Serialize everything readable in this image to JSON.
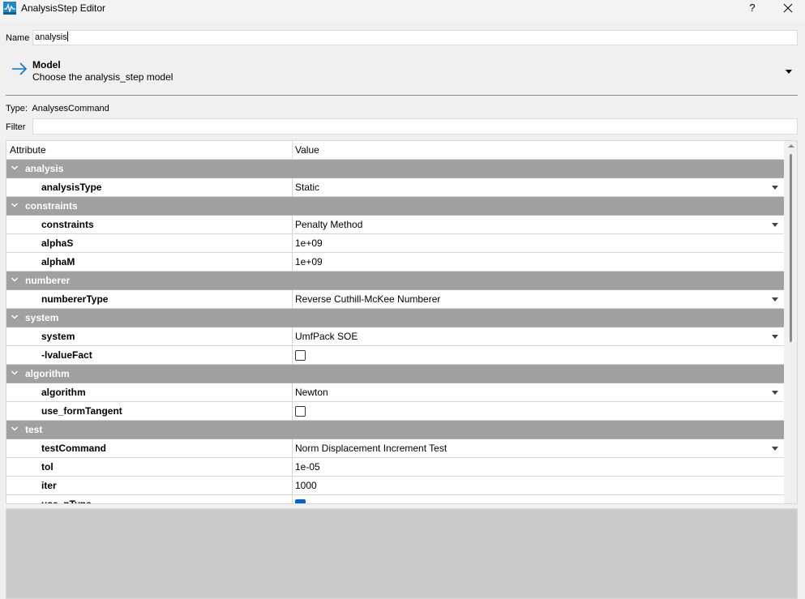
{
  "window": {
    "title": "AnalysisStep Editor",
    "help_label": "?",
    "icon": "app-icon"
  },
  "name": {
    "label": "Name",
    "value": "analysis"
  },
  "model": {
    "title": "Model",
    "subtitle": "Choose the analysis_step model",
    "icon": "arrow-right-icon"
  },
  "type": {
    "label": "Type:",
    "value": "AnalysesCommand"
  },
  "filter": {
    "label": "Filter",
    "value": ""
  },
  "table": {
    "columns": [
      "Attribute",
      "Value"
    ],
    "rows": [
      {
        "kind": "group",
        "label": "analysis"
      },
      {
        "kind": "attr",
        "label": "analysisType",
        "value": "Static",
        "editor": "dropdown"
      },
      {
        "kind": "group",
        "label": "constraints"
      },
      {
        "kind": "attr",
        "label": "constraints",
        "value": "Penalty Method",
        "editor": "dropdown"
      },
      {
        "kind": "attr",
        "label": "alphaS",
        "value": "1e+09",
        "editor": "text"
      },
      {
        "kind": "attr",
        "label": "alphaM",
        "value": "1e+09",
        "editor": "text"
      },
      {
        "kind": "group",
        "label": "numberer"
      },
      {
        "kind": "attr",
        "label": "numbererType",
        "value": "Reverse Cuthill-McKee Numberer",
        "editor": "dropdown"
      },
      {
        "kind": "group",
        "label": "system"
      },
      {
        "kind": "attr",
        "label": "system",
        "value": "UmfPack SOE",
        "editor": "dropdown"
      },
      {
        "kind": "attr",
        "label": "-lvalueFact",
        "value": "",
        "editor": "checkbox",
        "checked": false
      },
      {
        "kind": "group",
        "label": "algorithm"
      },
      {
        "kind": "attr",
        "label": "algorithm",
        "value": "Newton",
        "editor": "dropdown"
      },
      {
        "kind": "attr",
        "label": "use_formTangent",
        "value": "",
        "editor": "checkbox",
        "checked": false
      },
      {
        "kind": "group",
        "label": "test"
      },
      {
        "kind": "attr",
        "label": "testCommand",
        "value": "Norm Displacement Increment Test",
        "editor": "dropdown"
      },
      {
        "kind": "attr",
        "label": "tol",
        "value": "1e-05",
        "editor": "text"
      },
      {
        "kind": "attr",
        "label": "iter",
        "value": "1000",
        "editor": "text"
      },
      {
        "kind": "attr",
        "label": "use_pType",
        "value": "",
        "editor": "checkbox",
        "checked": true
      }
    ]
  },
  "colors": {
    "group_row": "#a0a0a0",
    "accent": "#0078d4",
    "bottom_panel": "#cacaca"
  }
}
